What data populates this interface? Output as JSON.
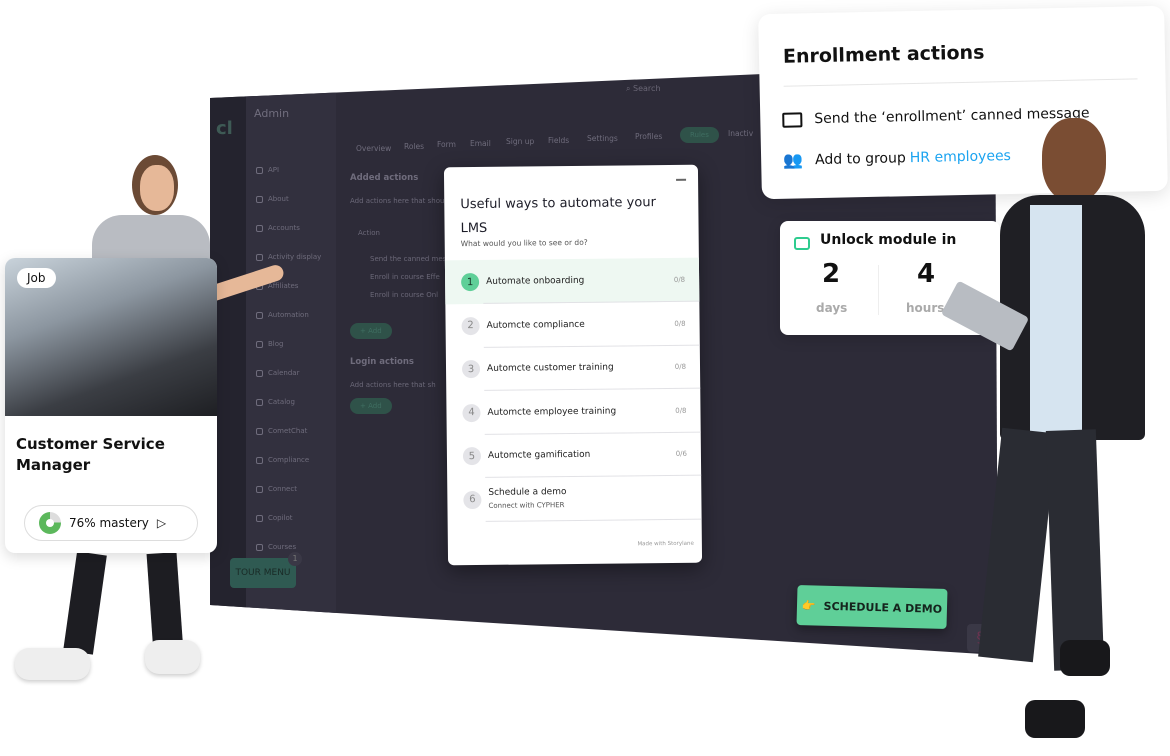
{
  "app": {
    "title": "Admin",
    "search_placeholder": "Search",
    "tabs": [
      "Overview",
      "Roles",
      "Form",
      "Email",
      "Sign up",
      "Fields",
      "Settings",
      "Profiles",
      "Rules",
      "Inactiv"
    ],
    "active_tab": "Rules",
    "nav": [
      "API",
      "About",
      "Accounts",
      "Activity display",
      "Affiliates",
      "Automation",
      "Blog",
      "Calendar",
      "Catalog",
      "CometChat",
      "Compliance",
      "Connect",
      "Copilot",
      "Courses"
    ],
    "added_actions": {
      "title": "Added actions",
      "desc": "Add actions here that shou",
      "col": "Action",
      "rows": [
        "Send the canned mes",
        "Enroll in course Effe",
        "Enroll in course Onl"
      ],
      "add": "+ Add"
    },
    "login_actions": {
      "title": "Login actions",
      "desc": "Add actions here that sh",
      "add": "+ Add"
    },
    "tour_menu": "TOUR MENU",
    "tour_badge": "1"
  },
  "modal": {
    "title": "Useful ways to automate your LMS",
    "subtitle": "What would you like to see or do?",
    "steps": [
      {
        "num": "1",
        "label": "Automate onboarding",
        "count": "0/8"
      },
      {
        "num": "2",
        "label": "Automcte compliance",
        "count": "0/8"
      },
      {
        "num": "3",
        "label": "Automcte customer training",
        "count": "0/8"
      },
      {
        "num": "4",
        "label": "Automcte employee training",
        "count": "0/8"
      },
      {
        "num": "5",
        "label": "Automcte gamification",
        "count": "0/6"
      },
      {
        "num": "6",
        "label": "Schedule a demo",
        "sub": "Connect with CYPHER"
      }
    ],
    "footer": "Made with Storylane"
  },
  "enrollment": {
    "title": "Enrollment actions",
    "item1": "Send the ‘enrollment’ canned message",
    "item2_prefix": "Add to group",
    "item2_link": "HR employees",
    "link_color": "#1aa3f0"
  },
  "unlock": {
    "title": "Unlock module in",
    "days_value": "2",
    "days_label": "days",
    "hours_value": "4",
    "hours_label": "hours",
    "accent": "#2ecc8f"
  },
  "job_card": {
    "badge": "Job",
    "title": "Customer Service Manager",
    "mastery": "76% mastery",
    "mastery_pct": 76
  },
  "cta": {
    "label": "SCHEDULE A DEMO",
    "color": "#5fcf98"
  }
}
